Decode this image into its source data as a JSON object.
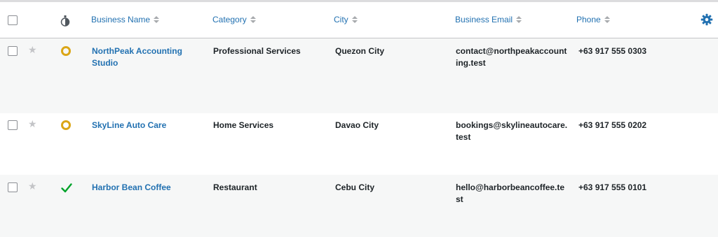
{
  "table": {
    "columns": {
      "business_name": "Business Name",
      "category": "Category",
      "city": "City",
      "email": "Business Email",
      "phone": "Phone"
    },
    "rows": [
      {
        "name": "NorthPeak Accounting Studio",
        "category": "Professional Services",
        "city": "Quezon City",
        "email": "contact@northpeakaccounting.test",
        "phone": "+63 917 555 0303",
        "status": "pending-ring-icon",
        "starred": false
      },
      {
        "name": "SkyLine Auto Care",
        "category": "Home Services",
        "city": "Davao City",
        "email": "bookings@skylineautocare.test",
        "phone": "+63 917 555 0202",
        "status": "pending-ring-icon",
        "starred": false
      },
      {
        "name": "Harbor Bean Coffee",
        "category": "Restaurant",
        "city": "Cebu City",
        "email": "hello@harborbeancoffee.test",
        "phone": "+63 917 555 0101",
        "status": "approved-check-icon",
        "starred": false
      }
    ]
  },
  "colors": {
    "link": "#2271b1",
    "pending": "#dba617",
    "approved": "#00a32a",
    "row_alt": "#f6f7f7"
  }
}
